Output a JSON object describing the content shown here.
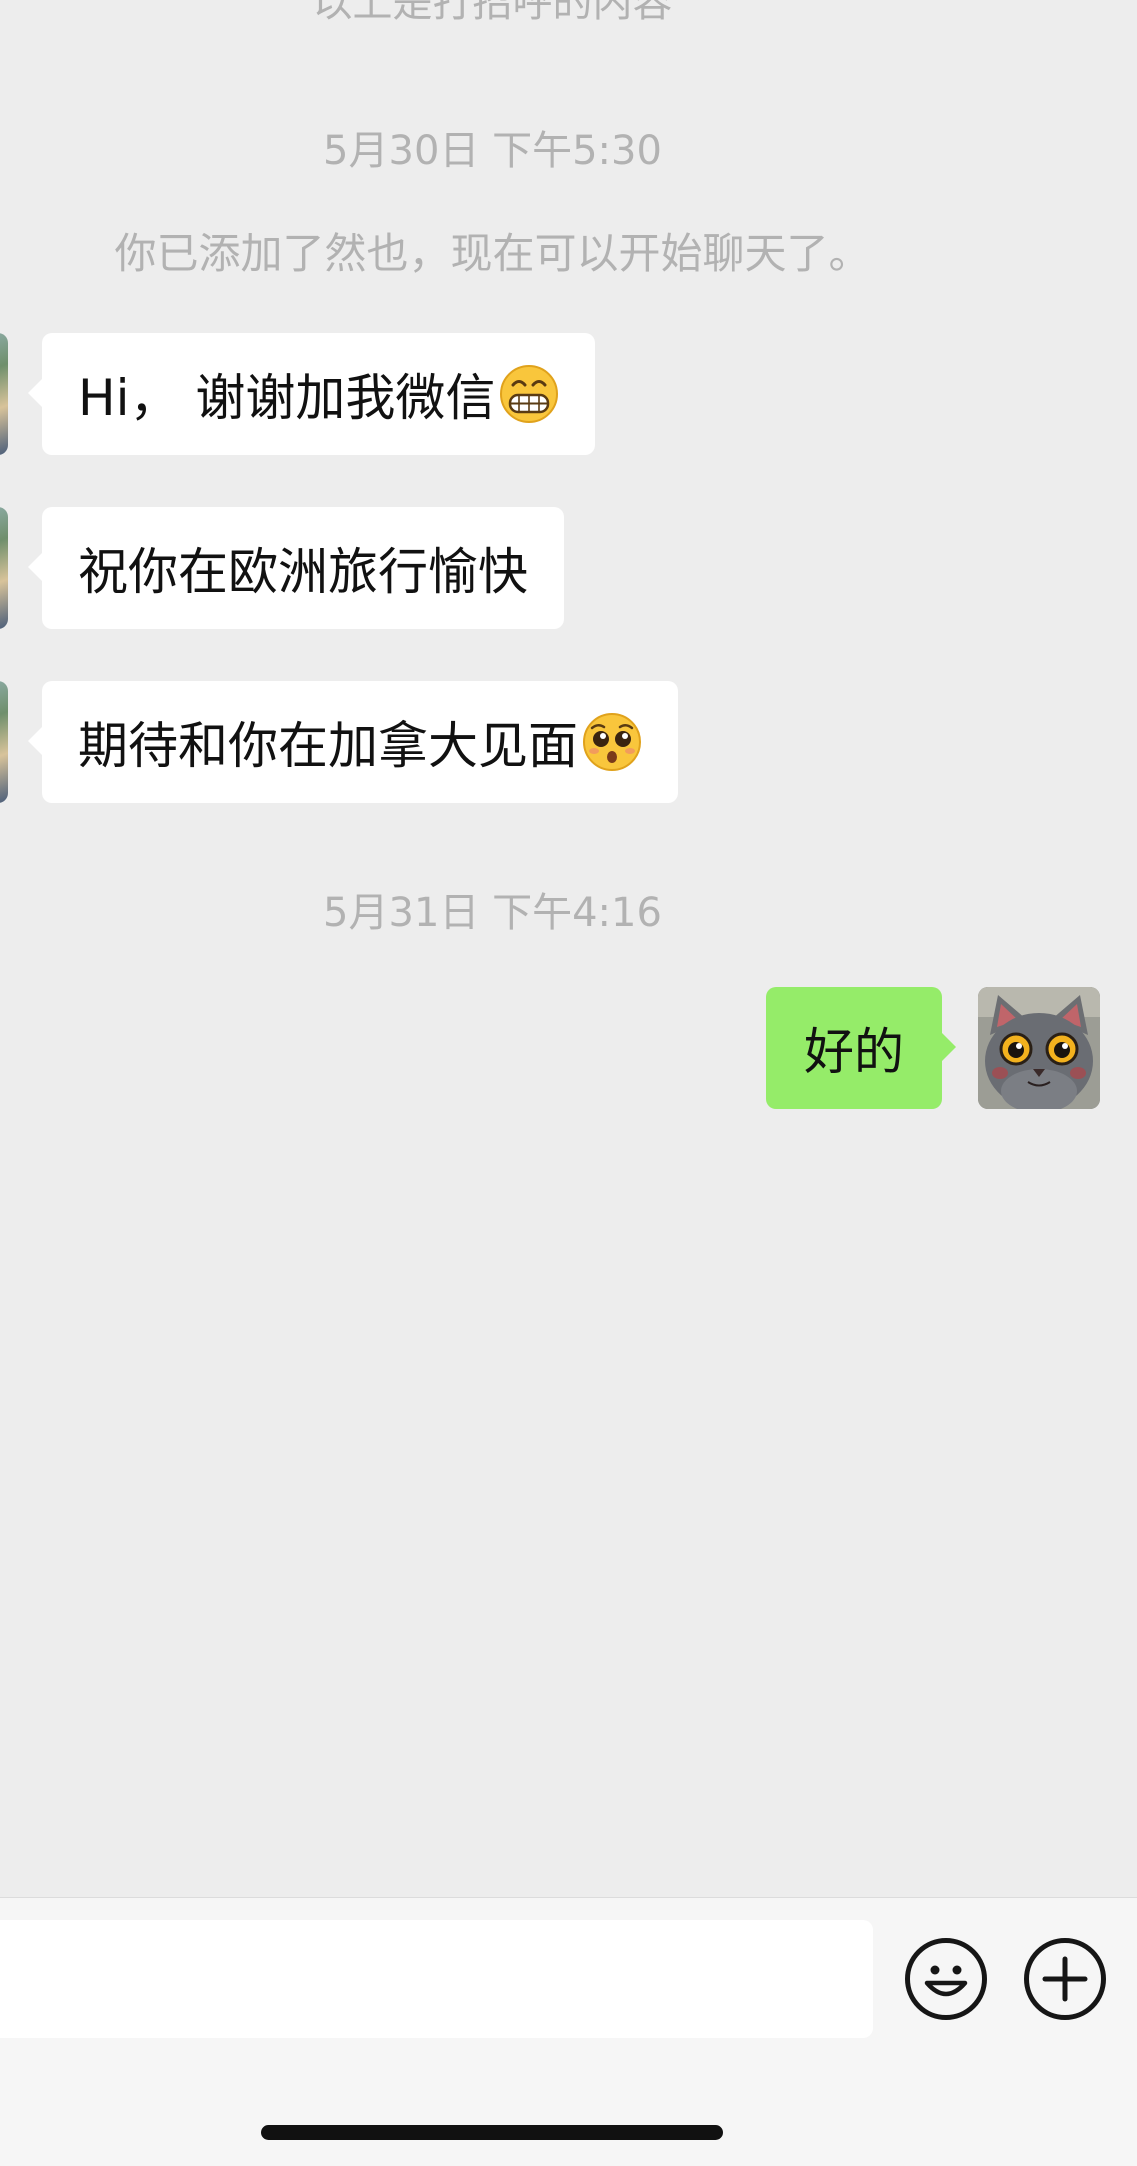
{
  "chat": {
    "greeting_notice": "以上是打招呼的内容",
    "timestamp_1": "5月30日 下午5:30",
    "added_notice": "你已添加了然也，现在可以开始聊天了。",
    "messages_left": [
      {
        "text": "Hi， 谢谢加我微信",
        "emoji": "grinning-face-emoji"
      },
      {
        "text": "祝你在欧洲旅行愉快"
      },
      {
        "text": "期待和你在加拿大见面",
        "emoji": "pleading-face-emoji"
      }
    ],
    "timestamp_2": "5月31日 下午4:16",
    "message_right": {
      "text": "好的"
    }
  },
  "input_bar": {
    "value": "",
    "emoji_button_icon": "smiley-icon",
    "more_button_icon": "plus-circle-icon"
  },
  "colors": {
    "background": "#ededed",
    "sent_bubble": "#95ec69",
    "received_bubble": "#ffffff",
    "system_text": "#b2b2b2"
  }
}
